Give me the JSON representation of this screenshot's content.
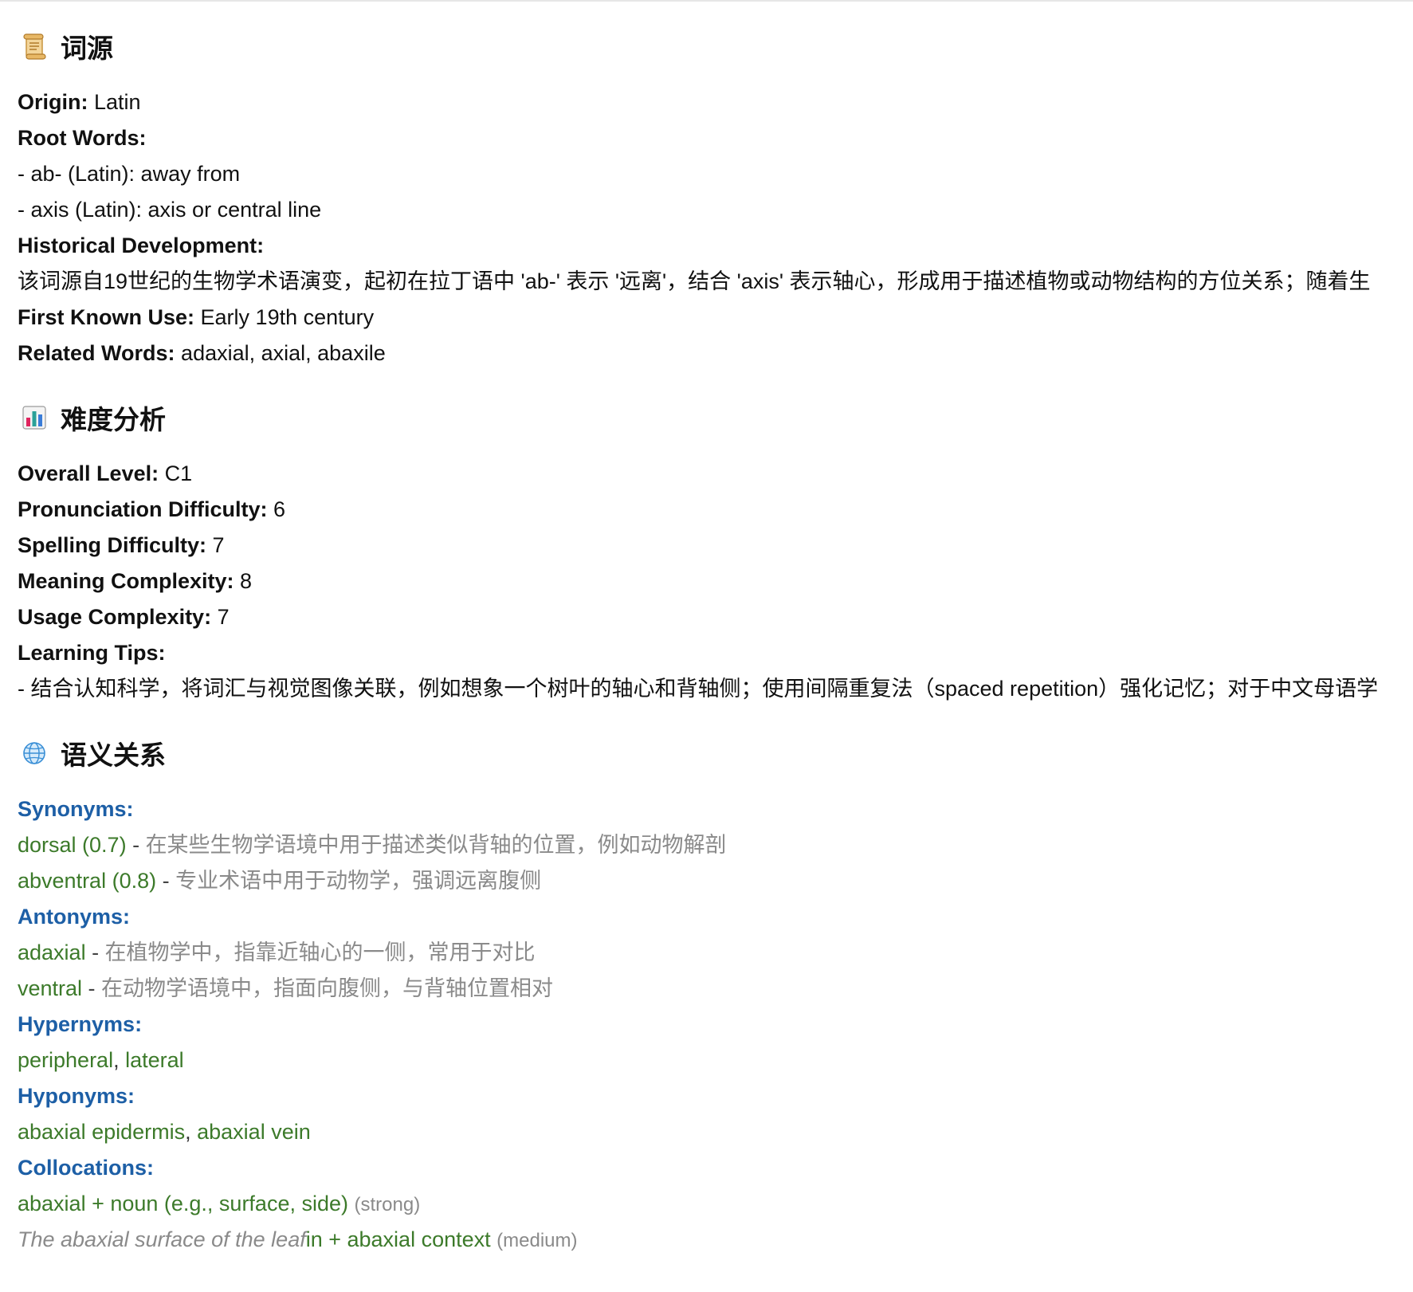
{
  "etymology": {
    "heading": "词源",
    "icon": "scroll-icon",
    "origin_label": "Origin:",
    "origin_value": "Latin",
    "root_words_label": "Root Words:",
    "root_words": [
      "- ab- (Latin): away from",
      "- axis (Latin): axis or central line"
    ],
    "historical_label": "Historical Development:",
    "historical_text": "该词源自19世纪的生物学术语演变，起初在拉丁语中 'ab-' 表示 '远离'，结合 'axis' 表示轴心，形成用于描述植物或动物结构的方位关系；随着生",
    "first_use_label": "First Known Use:",
    "first_use_value": "Early 19th century",
    "related_label": "Related Words:",
    "related_value": "adaxial, axial, abaxile"
  },
  "difficulty": {
    "heading": "难度分析",
    "icon": "bar-chart-icon",
    "overall_label": "Overall Level:",
    "overall_value": "C1",
    "pronunciation_label": "Pronunciation Difficulty:",
    "pronunciation_value": "6",
    "spelling_label": "Spelling Difficulty:",
    "spelling_value": "7",
    "meaning_label": "Meaning Complexity:",
    "meaning_value": "8",
    "usage_label": "Usage Complexity:",
    "usage_value": "7",
    "tips_label": "Learning Tips:",
    "tips_text": "- 结合认知科学，将词汇与视觉图像关联，例如想象一个树叶的轴心和背轴侧；使用间隔重复法（spaced repetition）强化记忆；对于中文母语学"
  },
  "semantic": {
    "heading": "语义关系",
    "icon": "globe-icon",
    "synonyms_label": "Synonyms:",
    "synonyms": [
      {
        "term": "dorsal (0.7)",
        "dash": " - ",
        "desc": "在某些生物学语境中用于描述类似背轴的位置，例如动物解剖"
      },
      {
        "term": "abventral (0.8)",
        "dash": " - ",
        "desc": "专业术语中用于动物学，强调远离腹侧"
      }
    ],
    "antonyms_label": "Antonyms:",
    "antonyms": [
      {
        "term": "adaxial",
        "dash": " - ",
        "desc": "在植物学中，指靠近轴心的一侧，常用于对比"
      },
      {
        "term": "ventral",
        "dash": " - ",
        "desc": "在动物学语境中，指面向腹侧，与背轴位置相对"
      }
    ],
    "hypernyms_label": "Hypernyms:",
    "hypernyms": [
      "peripheral",
      "lateral"
    ],
    "hyponyms_label": "Hyponyms:",
    "hyponyms": [
      "abaxial epidermis",
      "abaxial vein"
    ],
    "list_separator": ", ",
    "collocations_label": "Collocations:",
    "collocation_1": {
      "term": "abaxial + noun (e.g., surface, side)",
      "strength": "(strong)"
    },
    "collocation_2": {
      "example": "The abaxial surface of the leaf",
      "term": "in + abaxial context",
      "strength": "(medium)"
    }
  }
}
